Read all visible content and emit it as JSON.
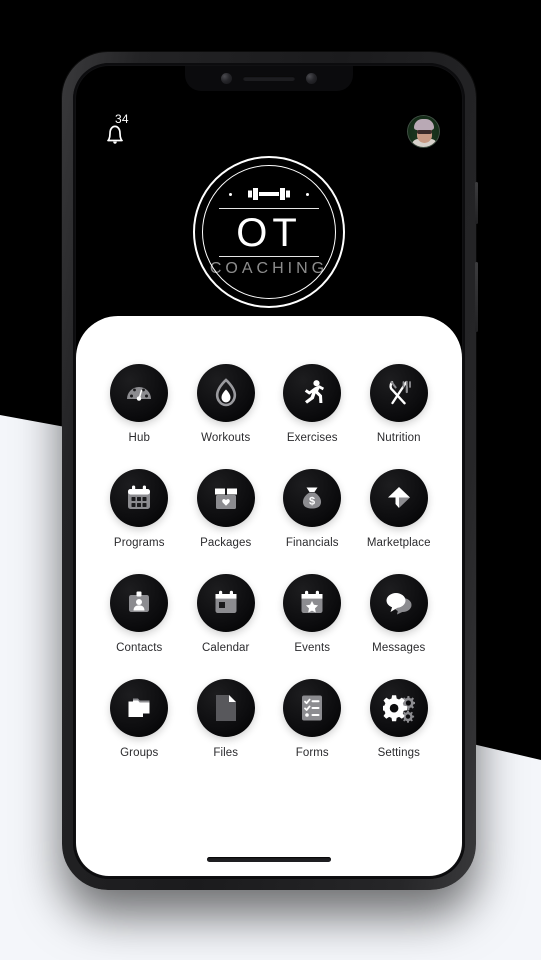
{
  "app": {
    "brand_name": "OT",
    "brand_subtitle": "COACHING",
    "logo_icon": "dumbbell-icon",
    "accent_dark": "#000000",
    "sheet_color": "#ffffff",
    "label_color": "#2b2b2e"
  },
  "header": {
    "notifications": {
      "icon": "bell-icon",
      "badge_count": "34"
    },
    "avatar": {
      "icon": "avatar",
      "alt": "user profile photo"
    }
  },
  "menu": {
    "items": [
      {
        "label": "Hub",
        "icon": "speedometer-icon"
      },
      {
        "label": "Workouts",
        "icon": "flame-icon"
      },
      {
        "label": "Exercises",
        "icon": "running-person-icon"
      },
      {
        "label": "Nutrition",
        "icon": "fork-knife-icon"
      },
      {
        "label": "Programs",
        "icon": "calendar-grid-icon"
      },
      {
        "label": "Packages",
        "icon": "box-heart-icon"
      },
      {
        "label": "Financials",
        "icon": "money-bag-icon"
      },
      {
        "label": "Marketplace",
        "icon": "paper-plane-icon"
      },
      {
        "label": "Contacts",
        "icon": "id-card-icon"
      },
      {
        "label": "Calendar",
        "icon": "calendar-icon"
      },
      {
        "label": "Events",
        "icon": "calendar-star-icon"
      },
      {
        "label": "Messages",
        "icon": "speech-bubbles-icon"
      },
      {
        "label": "Groups",
        "icon": "folders-icon"
      },
      {
        "label": "Files",
        "icon": "document-icon"
      },
      {
        "label": "Forms",
        "icon": "checklist-icon"
      },
      {
        "label": "Settings",
        "icon": "gears-icon"
      }
    ]
  }
}
